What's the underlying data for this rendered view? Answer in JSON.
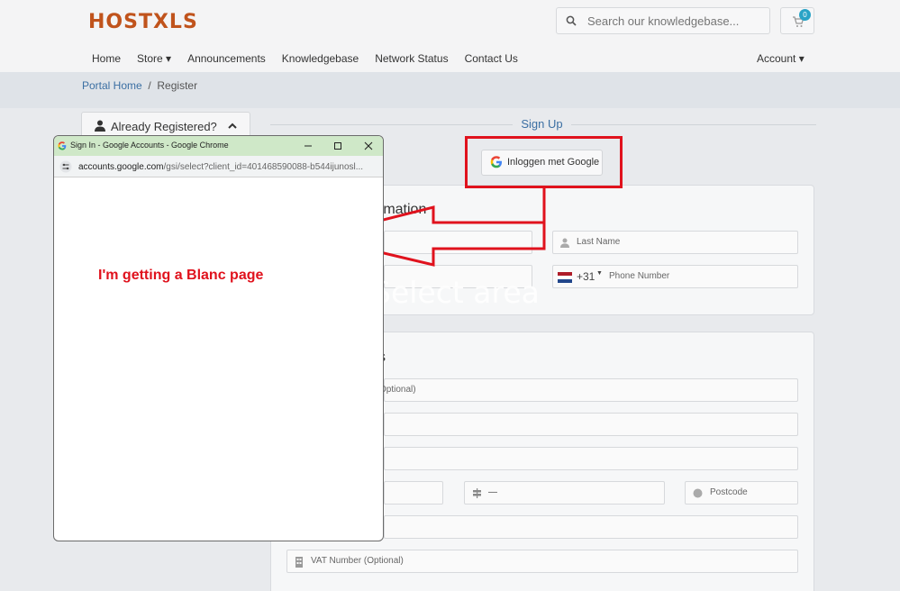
{
  "header": {
    "logo": "HOSTXLS",
    "search_placeholder": "Search our knowledgebase...",
    "cart_count": "0",
    "nav": [
      "Home",
      "Store ▾",
      "Announcements",
      "Knowledgebase",
      "Network Status",
      "Contact Us"
    ],
    "account": "Account ▾"
  },
  "breadcrumb": {
    "home": "Portal Home",
    "sep": "/",
    "current": "Register"
  },
  "sidebar": {
    "already_registered": "Already Registered?"
  },
  "form": {
    "signup_label": "Sign Up",
    "google_button": "Inloggen met Google",
    "personal_title_partial": "rmation",
    "last_name_placeholder": "Last Name",
    "phone_code": "+31",
    "phone_placeholder": "Phone Number",
    "billing_title_partial": "s",
    "company_placeholder_partial": "Optional)",
    "state_value": "—",
    "postcode_placeholder": "Postcode",
    "vat_placeholder": "VAT Number (Optional)"
  },
  "overlay": {
    "watermark": "Select area",
    "annotation": "I'm getting a Blanc page"
  },
  "popup": {
    "title": "Sign In - Google Accounts - Google Chrome",
    "url_host": "accounts.google.com",
    "url_path": "/gsi/select?client_id=401468590088-b544ijunosl..."
  },
  "colors": {
    "brand": "#c0531c",
    "annotation_red": "#e0121d",
    "link": "#3b6fa3",
    "badge": "#2aa3c6"
  }
}
